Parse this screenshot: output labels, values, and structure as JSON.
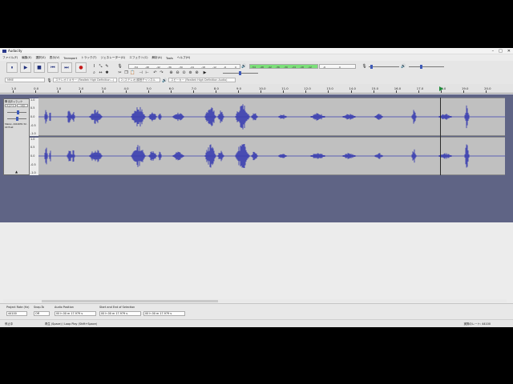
{
  "window": {
    "title": "Audacity",
    "buttons": [
      "–",
      "□",
      "✕"
    ]
  },
  "menu": [
    "ファイル(F)",
    "編集(E)",
    "選択(S)",
    "表示(V)",
    "Transport",
    "トラック(T)",
    "ジェネレーター(G)",
    "エフェクト(C)",
    "解析(A)",
    "Tools",
    "ヘルプ(H)"
  ],
  "transport": {
    "pause": "⏸",
    "play": "▶",
    "stop": "■",
    "skip_start": "⏮",
    "skip_end": "⏭",
    "record": "●"
  },
  "meters": {
    "record_ticks": [
      "-54",
      "-48",
      "-42",
      "-36",
      "-30",
      "-24",
      "-18",
      "-12",
      "-6",
      "0"
    ],
    "play_ticks": [
      "-54",
      "-48",
      "-42",
      "-36",
      "-30",
      "-24",
      "-18",
      "-12",
      "-6",
      "0"
    ],
    "record_hint": "モニタを開始するにはクリック"
  },
  "devices": {
    "host": "MME",
    "input": "ステレオミキサー (Realtek High Definition...)",
    "channels": "2 (ステレオ)録音チャンネル",
    "output": "スピーカー (Realtek High Definition Audio)"
  },
  "ruler": {
    "ticks": [
      "1.0",
      "0.0",
      "1.0",
      "2.0",
      "3.0",
      "4.0",
      "5.0",
      "6.0",
      "7.0",
      "8.0",
      "9.0",
      "10.0",
      "11.0",
      "12.0",
      "13.0",
      "14.0",
      "15.0",
      "16.0",
      "17.0",
      "18.0",
      "19.0",
      "20.0"
    ]
  },
  "track": {
    "name": "音声トラック",
    "close": "x",
    "mute": "ミュート",
    "solo": "ソロ",
    "info": "Stereo, 44100Hz 32-bit float",
    "scale": [
      "1.0",
      "0.5",
      "0.0",
      "-0.5",
      "-1.0"
    ]
  },
  "selection": {
    "rate_label": "Project Rate (Hz)",
    "rate_value": "44100",
    "snap_label": "Snap-To",
    "snap_value": "Off",
    "audio_pos_label": "Audio Position",
    "audio_pos_value": "00 h 00 m 17.979 s",
    "sel_label": "Start and End of Selection",
    "sel_start": "00 h 00 m 17.979 s",
    "sel_end": "00 h 00 m 17.979 s"
  },
  "status": {
    "state": "停止中",
    "hint": "再生 (Space) / Loop Play (Shift+Space)",
    "rate": "実際のレート: 44100"
  },
  "colors": {
    "wave": "#3a3fb0",
    "lane": "#c0c0c0",
    "background": "#5f6485",
    "meter_green": "#7be079"
  }
}
